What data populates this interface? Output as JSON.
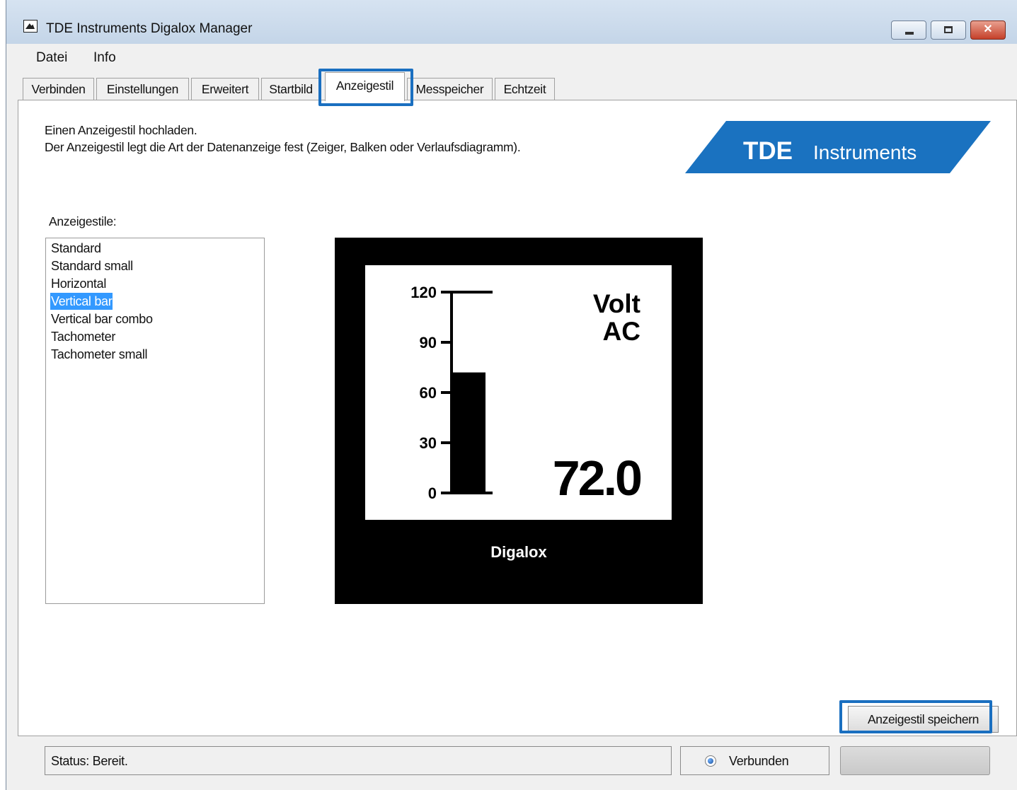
{
  "window": {
    "title": "TDE Instruments Digalox Manager",
    "controls": {
      "minimize": "minimize",
      "maximize": "maximize",
      "close": "close"
    }
  },
  "menu": [
    "Datei",
    "Info"
  ],
  "tabs": [
    "Verbinden",
    "Einstellungen",
    "Erweitert",
    "Startbild",
    "Anzeigestil",
    "Messpeicher",
    "Echtzeit"
  ],
  "active_tab": "Anzeigestil",
  "description": {
    "line1": "Einen Anzeigestil hochladen.",
    "line2": "Der Anzeigestil legt die Art der Datenanzeige fest (Zeiger, Balken oder Verlaufsdiagramm)."
  },
  "logo": {
    "brand": "TDE",
    "text": "Instruments",
    "color": "#1a72c0"
  },
  "styles_label": "Anzeigestile:",
  "styles": [
    "Standard",
    "Standard small",
    "Horizontal",
    "Vertical bar",
    "Vertical bar combo",
    "Tachometer",
    "Tachometer small"
  ],
  "selected_style": "Vertical bar",
  "preview": {
    "device_label": "Digalox",
    "unit_line1": "Volt",
    "unit_line2": "AC",
    "value": "72.0",
    "scale_ticks": [
      "0",
      "30",
      "60",
      "90",
      "120"
    ],
    "scale_max": 120,
    "bar_value": 72
  },
  "save_button": "Anzeigestil speichern",
  "status": "Status: Bereit.",
  "connection": "Verbunden",
  "highlight_color": "#1a6fc0"
}
